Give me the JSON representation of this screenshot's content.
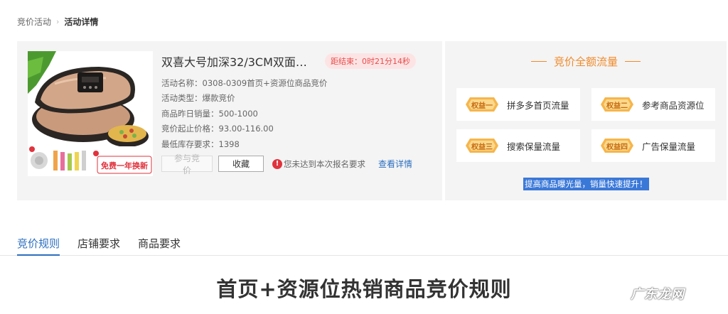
{
  "breadcrumb": {
    "parent": "竞价活动",
    "current": "活动详情"
  },
  "product": {
    "title": "双喜大号加深32/3CM双面煎...",
    "countdown": "距结束：0时21分14秒",
    "image_promo": "免费一年换新",
    "info": [
      "活动名称：0308-0309首页+资源位商品竞价",
      "活动类型：爆款竞价",
      "商品昨日销量：500-1000",
      "竞价起止价格：93.00-116.00",
      "最低库存要求：1398"
    ],
    "join_label": "参与竞价",
    "fav_label": "收藏",
    "warning": "您未达到本次报名要求",
    "detail_link": "查看详情"
  },
  "benefits": {
    "title": "竞价全额流量",
    "items": [
      {
        "tag": "权益一",
        "label": "拼多多首页流量"
      },
      {
        "tag": "权益二",
        "label": "参考商品资源位"
      },
      {
        "tag": "权益三",
        "label": "搜索保量流量"
      },
      {
        "tag": "权益四",
        "label": "广告保量流量"
      }
    ],
    "tagline": "提高商品曝光量，销量快速提升！"
  },
  "tabs": [
    "竞价规则",
    "店铺要求",
    "商品要求"
  ],
  "content_title": "首页+资源位热销商品竞价规则",
  "watermark": "广东龙网",
  "colors": {
    "accent_blue": "#2c6fbf",
    "benefit_orange": "#f08a2a",
    "countdown_red": "#e84d4d"
  }
}
